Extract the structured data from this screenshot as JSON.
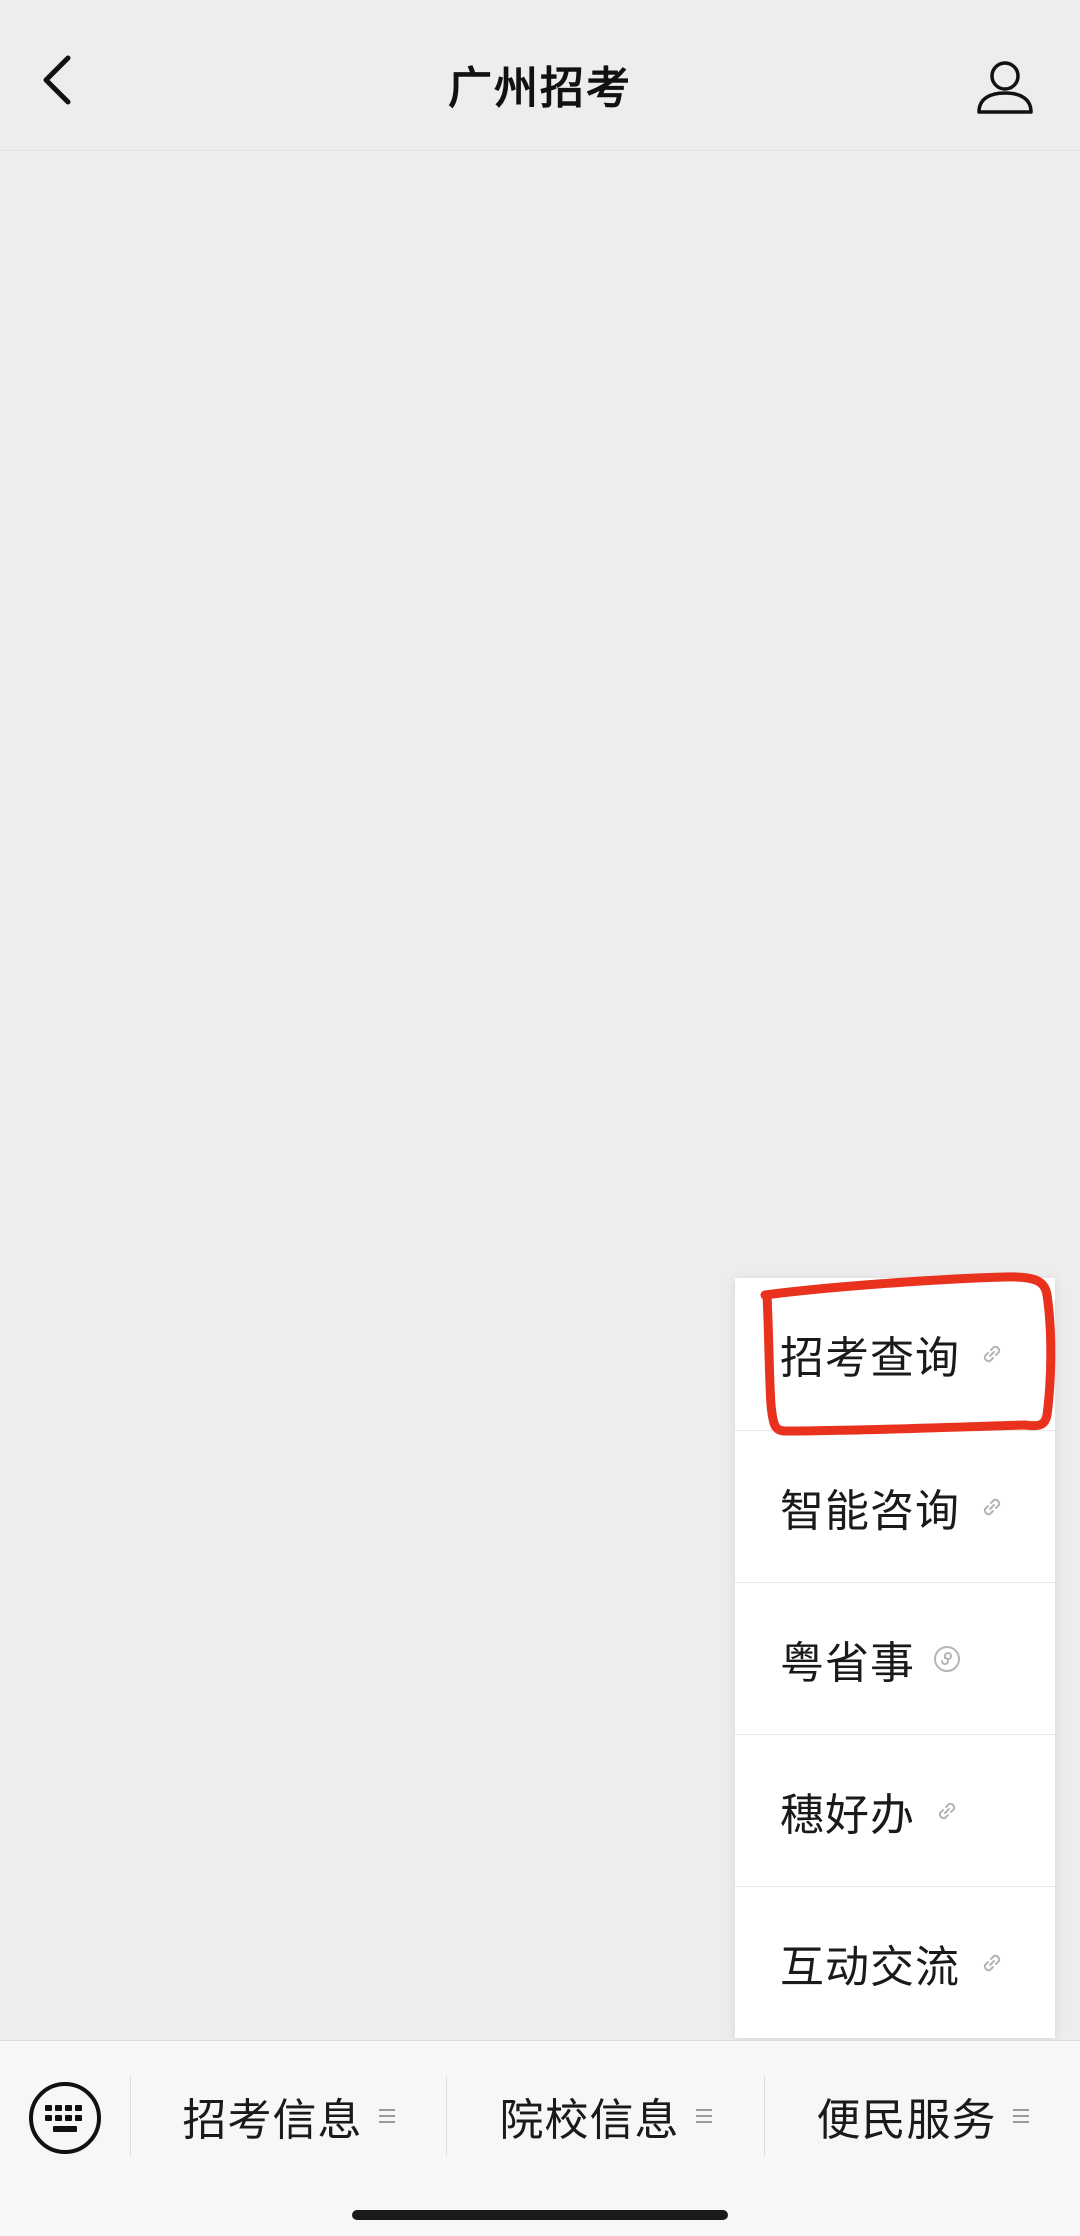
{
  "header": {
    "title": "广州招考"
  },
  "submenu": {
    "items": [
      {
        "label": "招考查询",
        "icon": "link-icon"
      },
      {
        "label": "智能咨询",
        "icon": "link-icon"
      },
      {
        "label": "粤省事",
        "icon": "mini-program-icon"
      },
      {
        "label": "穗好办",
        "icon": "link-icon"
      },
      {
        "label": "互动交流",
        "icon": "link-icon"
      }
    ]
  },
  "bottombar": {
    "menus": [
      {
        "label": "招考信息"
      },
      {
        "label": "院校信息"
      },
      {
        "label": "便民服务"
      }
    ]
  },
  "colors": {
    "background": "#ededed",
    "highlight": "#e8321e"
  }
}
